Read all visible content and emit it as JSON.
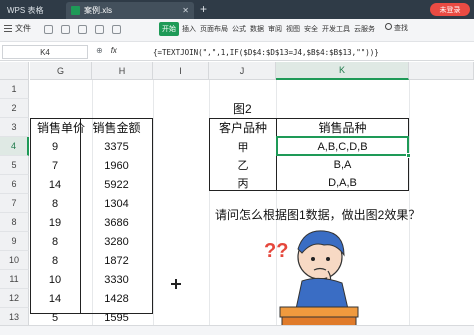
{
  "titlebar": {
    "app_tab": "WPS 表格",
    "doc_tab": "案例.xls",
    "add_tab": "+",
    "login_button": "未登录"
  },
  "toolbar": {
    "file_menu": "文件",
    "ribbon_tabs": [
      "开始",
      "插入",
      "页面布局",
      "公式",
      "数据",
      "审阅",
      "视图",
      "安全",
      "开发工具",
      "云服务"
    ],
    "active_tab": "开始",
    "search_label": "查找"
  },
  "formula_bar": {
    "name_box": "K4",
    "fx_label": "fx",
    "formula": "{=TEXTJOIN(\",\",1,IF($D$4:$D$13=J4,$B$4:$B$13,\"\"))}"
  },
  "grid": {
    "columns": [
      "G",
      "H",
      "I",
      "J",
      "K"
    ],
    "selected_column": "K",
    "rows": [
      "1",
      "2",
      "3",
      "4",
      "5",
      "6",
      "7",
      "8",
      "9",
      "10",
      "11",
      "12",
      "13"
    ],
    "selected_row": "4"
  },
  "table1": {
    "headers": [
      "销售单价",
      "销售金额"
    ],
    "rows": [
      [
        "9",
        "3375"
      ],
      [
        "7",
        "1960"
      ],
      [
        "14",
        "5922"
      ],
      [
        "8",
        "1304"
      ],
      [
        "19",
        "3686"
      ],
      [
        "8",
        "3280"
      ],
      [
        "8",
        "1872"
      ],
      [
        "10",
        "3330"
      ],
      [
        "14",
        "1428"
      ],
      [
        "5",
        "1595"
      ]
    ]
  },
  "table2": {
    "caption": "图2",
    "headers": [
      "客户品种",
      "销售品种"
    ],
    "rows": [
      [
        "甲",
        "A,B,C,D,B"
      ],
      [
        "乙",
        "B,A"
      ],
      [
        "丙",
        "D,A,B"
      ]
    ]
  },
  "question": "请问怎么根据图1数据，做出图2效果？",
  "illustration": {
    "marks": "??"
  }
}
